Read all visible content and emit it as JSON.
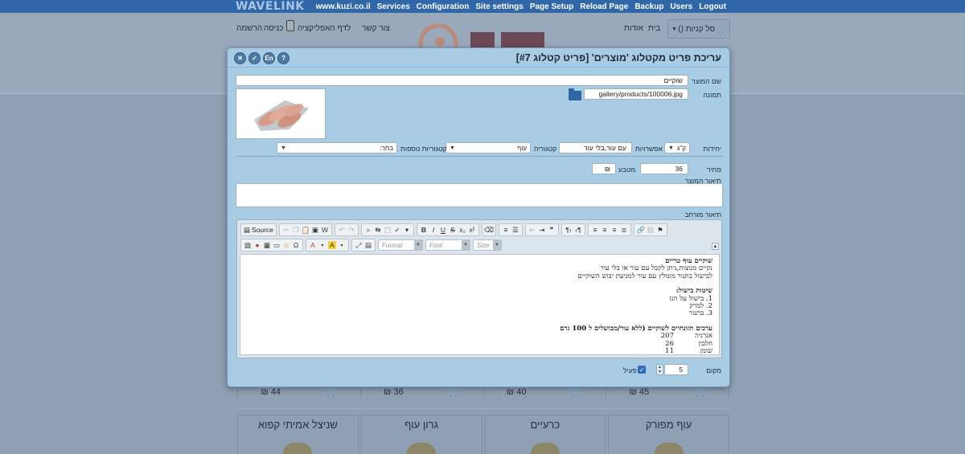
{
  "topbar": {
    "brand": "WAVELINK",
    "links": [
      "www.kuzi.co.il",
      "Services",
      "Configuration",
      "Site settings",
      "Page Setup",
      "Reload Page",
      "Backup",
      "Users",
      "Logout"
    ]
  },
  "site": {
    "nav_right": [
      "בית",
      "אודות"
    ],
    "cart_label": "סל קניות ()",
    "nav_left": [
      "צור קשר",
      "לדף האפליקציה",
      "כניסה",
      "הרשמה"
    ],
    "prices": [
      "₪ 45",
      "₪ 40",
      "₪ 36",
      "₪ 44"
    ],
    "categories": [
      "עוף מפורק",
      "כרעיים",
      "גרון עוף",
      "שניצל אמיתי קפוא"
    ]
  },
  "dialog": {
    "title": "עריכת פריט מקטלוג 'מוצרים' [פריט קטלוג #7]",
    "fields": {
      "product_name_label": "שם המוצר",
      "product_name_value": "שוקיים",
      "image_label": "תמונה",
      "image_path": "gallery/products/100006.jpg",
      "unit_label": "יחידות",
      "unit_value": "ק\"ג",
      "options_label": "אפשרויות",
      "options_value": "עם עור,בלי עור",
      "category_label": "קטגוריה",
      "category_value": "עוף",
      "extra_categories_label": "קטגוריות נוספות",
      "extra_categories_value": "בחר:",
      "price_label": "מחיר",
      "price_value": "36",
      "currency_label": "מטבע",
      "currency_value": "₪",
      "description_label": "תיאור המוצר",
      "extended_description_label": "תיאור מורחב",
      "position_label": "מקום",
      "position_value": "5",
      "active_label": "פעיל"
    },
    "editor": {
      "source_label": "Source",
      "format_placeholder": "Format",
      "font_placeholder": "Font",
      "size_placeholder": "Size",
      "content": {
        "heading1": "שוקיים עוף טריים",
        "line1": "נקיים מנוצות,ניתן לקבל עם עור או בלי עור",
        "line2": "לבישול בתנור מומלץ עם עור למניעת יבוש השוקיים",
        "heading2": "שיטות בישול:",
        "methods": [
          "1. בישול על הגז",
          "2. למרק",
          "3. בתנור"
        ],
        "heading3": "ערכים תזונתיים לשוקיים (ללא עור/מבושלים ל 100 גרם",
        "nutrition": [
          {
            "name": "אנרגיה",
            "value": "207"
          },
          {
            "name": "חלבון",
            "value": "26"
          },
          {
            "name": "שומן",
            "value": "11"
          }
        ]
      }
    }
  }
}
